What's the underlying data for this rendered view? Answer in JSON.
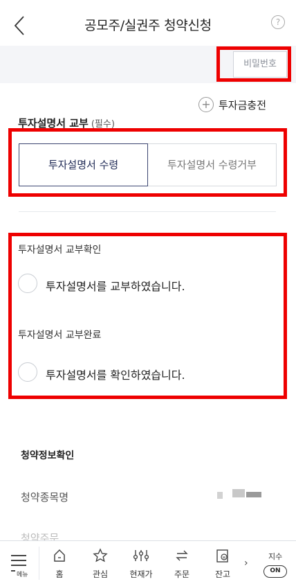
{
  "header": {
    "title": "공모주/실권주 청약신청",
    "help_glyph": "?"
  },
  "account": {
    "password_button": "비밀번호"
  },
  "charge": {
    "label": "투자금충전",
    "plus_glyph": "+"
  },
  "prospectus": {
    "title": "투자설명서 교부",
    "required_tag": "(필수)",
    "options": [
      {
        "label": "투자설명서 수령",
        "selected": true
      },
      {
        "label": "투자설명서 수령거부",
        "selected": false
      }
    ]
  },
  "confirmations": [
    {
      "label": "투자설명서 교부확인",
      "radio_text": "투자설명서를 교부하였습니다.",
      "checked": false
    },
    {
      "label": "투자설명서 교부완료",
      "radio_text": "투자설명서를 확인하였습니다.",
      "checked": false
    }
  ],
  "subscription_info": {
    "title": "청약정보확인",
    "fields": [
      {
        "label": "청약종목명"
      },
      {
        "label": "청약주문"
      }
    ]
  },
  "tabbar": {
    "menu_label": "메뉴",
    "tabs": [
      {
        "label": "홈",
        "icon": "home-icon"
      },
      {
        "label": "관심",
        "icon": "star-icon"
      },
      {
        "label": "현재가",
        "icon": "sliders-icon"
      },
      {
        "label": "주문",
        "icon": "swap-icon"
      },
      {
        "label": "잔고",
        "icon": "wallet-icon"
      }
    ],
    "more_glyph": "›",
    "index_label": "지수",
    "index_toggle": "ON"
  },
  "highlight_color": "#ee0000",
  "accent_color": "#1f2a55"
}
